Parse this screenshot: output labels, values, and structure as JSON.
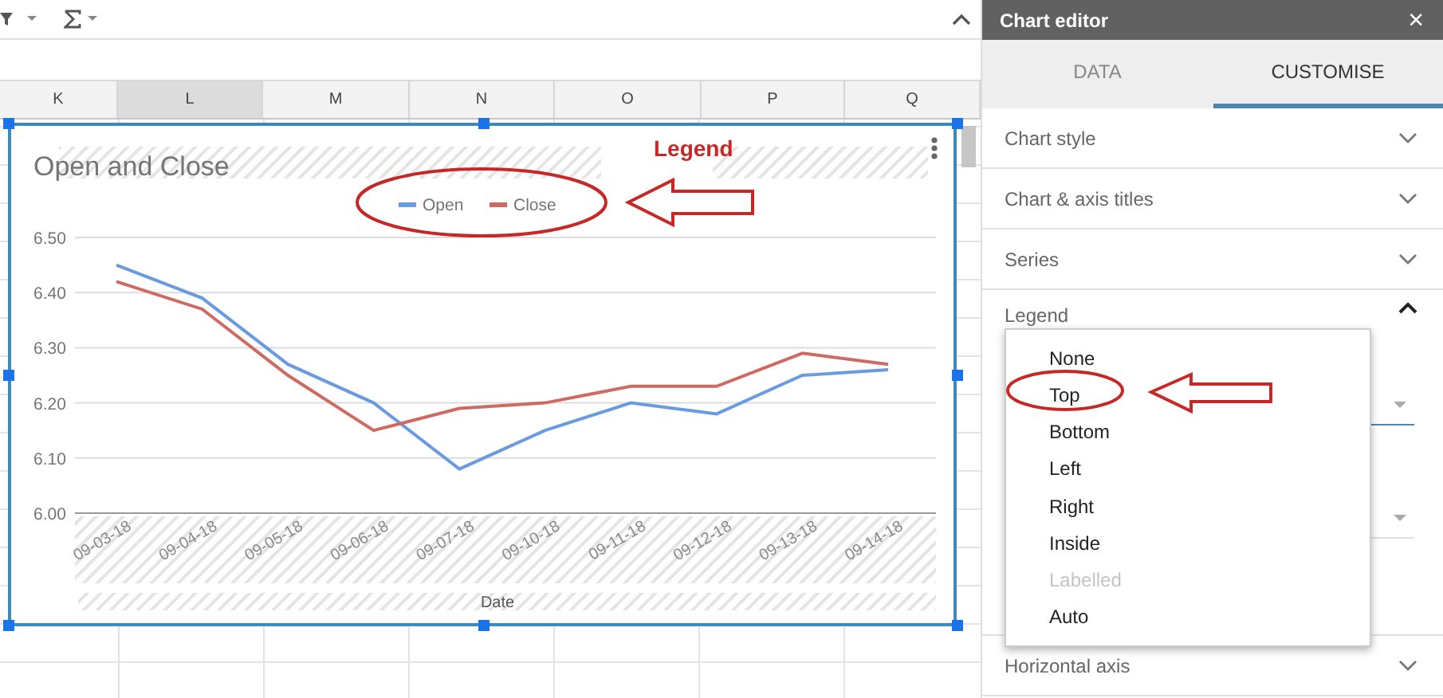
{
  "columns": [
    {
      "label": "K",
      "selected": false
    },
    {
      "label": "L",
      "selected": true
    },
    {
      "label": "M",
      "selected": false
    },
    {
      "label": "N",
      "selected": false
    },
    {
      "label": "O",
      "selected": false
    },
    {
      "label": "P",
      "selected": false
    },
    {
      "label": "Q",
      "selected": false
    }
  ],
  "chart": {
    "chart_data": {
      "type": "line",
      "title": "Open and Close",
      "xlabel": "Date",
      "categories": [
        "09-03-18",
        "09-04-18",
        "09-05-18",
        "09-06-18",
        "09-07-18",
        "09-10-18",
        "09-11-18",
        "09-12-18",
        "09-13-18",
        "09-14-18"
      ],
      "series": [
        {
          "name": "Open",
          "color": "#6a9be0",
          "values": [
            6.45,
            6.39,
            6.27,
            6.2,
            6.08,
            6.15,
            6.2,
            6.18,
            6.25,
            6.26
          ]
        },
        {
          "name": "Close",
          "color": "#cf6a63",
          "values": [
            6.42,
            6.37,
            6.25,
            6.15,
            6.19,
            6.2,
            6.23,
            6.23,
            6.29,
            6.27
          ]
        }
      ],
      "ylim": [
        6.0,
        6.5
      ],
      "grid": true,
      "legend": true,
      "yticks": [
        {
          "value": 6.0,
          "label": "6.00"
        },
        {
          "value": 6.1,
          "label": "6.10"
        },
        {
          "value": 6.2,
          "label": "6.20"
        },
        {
          "value": 6.3,
          "label": "6.30"
        },
        {
          "value": 6.4,
          "label": "6.40"
        },
        {
          "value": 6.5,
          "label": "6.50"
        }
      ]
    }
  },
  "annotation": {
    "label": "Legend"
  },
  "editor": {
    "title": "Chart editor",
    "close": "×",
    "tabs": [
      {
        "label": "DATA",
        "selected": false
      },
      {
        "label": "CUSTOMISE",
        "selected": true
      }
    ],
    "sections": [
      {
        "label": "Chart style",
        "expanded": false
      },
      {
        "label": "Chart & axis titles",
        "expanded": false
      },
      {
        "label": "Series",
        "expanded": false
      },
      {
        "label": "Legend",
        "expanded": true
      },
      {
        "label": "Horizontal axis",
        "expanded": false
      }
    ],
    "dropdown": [
      {
        "label": "None",
        "disabled": false
      },
      {
        "label": "Top",
        "disabled": false
      },
      {
        "label": "Bottom",
        "disabled": false
      },
      {
        "label": "Left",
        "disabled": false
      },
      {
        "label": "Right",
        "disabled": false
      },
      {
        "label": "Inside",
        "disabled": false
      },
      {
        "label": "Labelled",
        "disabled": true
      },
      {
        "label": "Auto",
        "disabled": false
      }
    ]
  }
}
